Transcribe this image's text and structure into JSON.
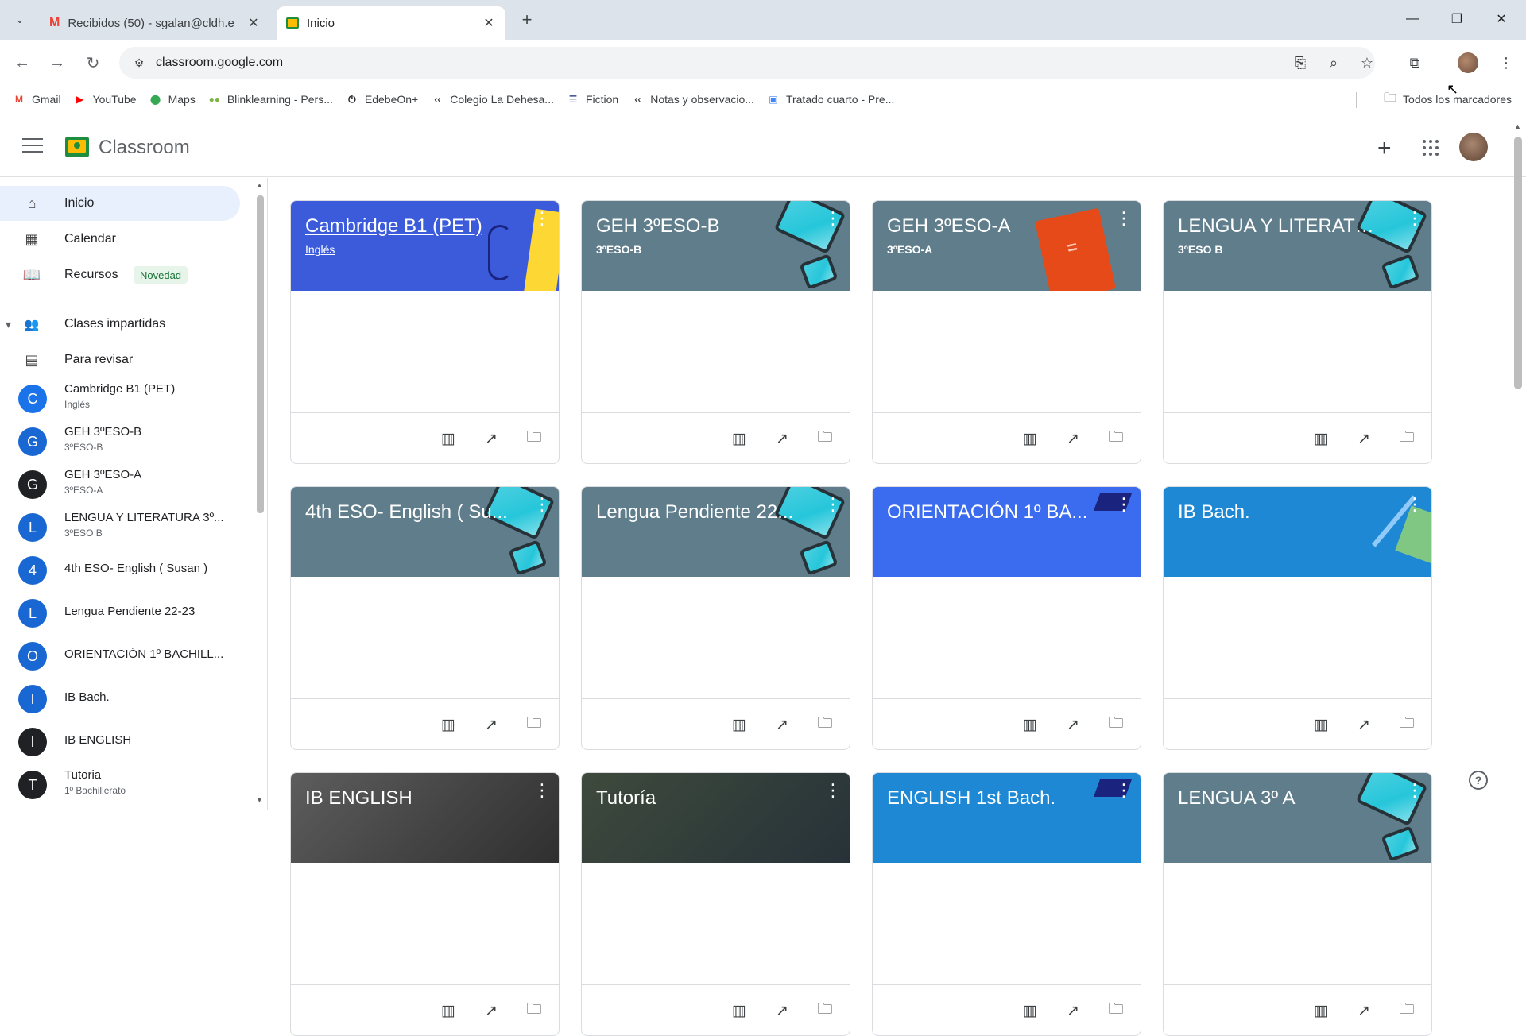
{
  "browser": {
    "tabs": [
      {
        "title": "Recibidos (50) - sgalan@cldh.e",
        "icon": "gmail-icon",
        "active": false
      },
      {
        "title": "Inicio",
        "icon": "classroom-icon",
        "active": true
      }
    ],
    "url": "classroom.google.com",
    "bookmarks": [
      {
        "label": "Gmail",
        "icon": "gmail-icon",
        "glyph": "M",
        "color": "#ea4335"
      },
      {
        "label": "YouTube",
        "icon": "youtube-icon",
        "glyph": "▶",
        "color": "#ff0000"
      },
      {
        "label": "Maps",
        "icon": "maps-icon",
        "glyph": "⬤",
        "color": "#34a853"
      },
      {
        "label": "Blinklearning - Pers...",
        "icon": "blinklearning-icon",
        "glyph": "●●",
        "color": "#7cb342"
      },
      {
        "label": "EdebeOn+",
        "icon": "edebe-icon",
        "glyph": "⏻",
        "color": "#202124"
      },
      {
        "label": "Colegio La Dehesa...",
        "icon": "colegio-icon",
        "glyph": "‹‹",
        "color": "#3c4043"
      },
      {
        "label": "Fiction",
        "icon": "fiction-icon",
        "glyph": "☰",
        "color": "#1a237e"
      },
      {
        "label": "Notas y observacio...",
        "icon": "notas-icon",
        "glyph": "‹‹",
        "color": "#3c4043"
      },
      {
        "label": "Tratado cuarto - Pre...",
        "icon": "tratado-icon",
        "glyph": "▣",
        "color": "#4285f4"
      }
    ],
    "all_bookmarks": "Todos los marcadores"
  },
  "app": {
    "name": "Classroom"
  },
  "sidebar": {
    "nav": [
      {
        "label": "Inicio",
        "icon": "home-icon",
        "glyph": "⌂"
      },
      {
        "label": "Calendar",
        "icon": "calendar-icon",
        "glyph": "▦"
      },
      {
        "label": "Recursos",
        "icon": "resources-icon",
        "glyph": "📖",
        "badge": "Novedad"
      }
    ],
    "teaching_header": "Clases impartidas",
    "to_review": "Para revisar",
    "classes": [
      {
        "letter": "C",
        "name": "Cambridge B1 (PET)",
        "sub": "Inglés",
        "color": "#1a73e8"
      },
      {
        "letter": "G",
        "name": "GEH 3ºESO-B",
        "sub": "3ºESO-B",
        "color": "#1967d2"
      },
      {
        "letter": "G",
        "name": "GEH 3ºESO-A",
        "sub": "3ºESO-A",
        "color": "#202124"
      },
      {
        "letter": "L",
        "name": "LENGUA Y LITERATURA 3º...",
        "sub": "3ºESO B",
        "color": "#1967d2"
      },
      {
        "letter": "4",
        "name": "4th ESO- English ( Susan )",
        "sub": "",
        "color": "#1967d2"
      },
      {
        "letter": "L",
        "name": "Lengua Pendiente 22-23",
        "sub": "",
        "color": "#1967d2"
      },
      {
        "letter": "O",
        "name": "ORIENTACIÓN 1º BACHILL...",
        "sub": "",
        "color": "#1967d2"
      },
      {
        "letter": "I",
        "name": "IB Bach.",
        "sub": "",
        "color": "#1967d2"
      },
      {
        "letter": "I",
        "name": "IB ENGLISH",
        "sub": "",
        "color": "#202124"
      },
      {
        "letter": "T",
        "name": "Tutoria",
        "sub": "1º Bachillerato",
        "color": "#202124"
      }
    ]
  },
  "cards": [
    {
      "title": "Cambridge B1 (PET)",
      "sub": "Inglés",
      "bg": "#3b5bdb",
      "style": "headphones",
      "link": true
    },
    {
      "title": "GEH 3ºESO-B",
      "sub": "3ºESO-B",
      "bg": "#607d8b",
      "style": "tablets"
    },
    {
      "title": "GEH 3ºESO-A",
      "sub": "3ºESO-A",
      "bg": "#607d8b",
      "style": "book"
    },
    {
      "title": "LENGUA Y LITERATU...",
      "sub": "3ºESO B",
      "bg": "#607d8b",
      "style": "tablets"
    },
    {
      "title": "4th ESO- English ( Su...",
      "sub": "",
      "bg": "#607d8b",
      "style": "tablets"
    },
    {
      "title": "Lengua Pendiente 22...",
      "sub": "",
      "bg": "#607d8b",
      "style": "tablets"
    },
    {
      "title": "ORIENTACIÓN 1º BA...",
      "sub": "",
      "bg": "#3b6cf0",
      "style": "cap"
    },
    {
      "title": "IB Bach.",
      "sub": "",
      "bg": "#1e88d5",
      "style": "pen"
    },
    {
      "title": "IB ENGLISH",
      "sub": "",
      "bg": "#4e4e4e",
      "style": "photo"
    },
    {
      "title": "Tutoría",
      "sub": "",
      "bg": "#37474f",
      "style": "chalk"
    },
    {
      "title": "ENGLISH 1st Bach.",
      "sub": "",
      "bg": "#1e88d5",
      "style": "cap"
    },
    {
      "title": "LENGUA 3º A",
      "sub": "",
      "bg": "#607d8b",
      "style": "tablets"
    }
  ],
  "card_actions": [
    {
      "icon": "gradebook-icon",
      "glyph": "▥"
    },
    {
      "icon": "insights-icon",
      "glyph": "↗"
    },
    {
      "icon": "folder-icon",
      "glyph": "🗀"
    }
  ]
}
